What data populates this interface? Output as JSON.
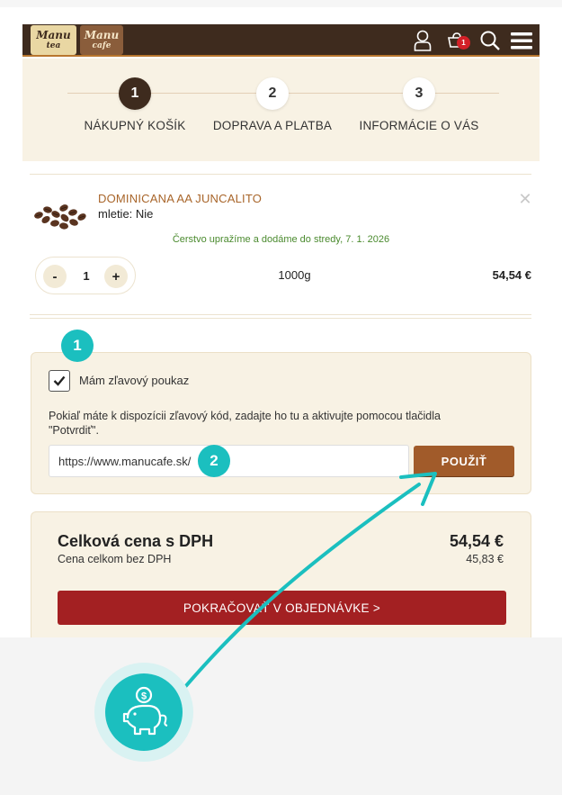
{
  "header": {
    "logo_left": "Manu",
    "logo_left_sub": "tea",
    "logo_right": "Manu",
    "logo_right_sub": "cafe",
    "cart_count": "1",
    "icons": [
      "user-icon",
      "cart-icon",
      "search-icon",
      "menu-icon"
    ]
  },
  "steps": [
    {
      "number": "1",
      "label": "NÁKUPNÝ KOŠÍK",
      "active": true
    },
    {
      "number": "2",
      "label": "DOPRAVA A PLATBA",
      "active": false
    },
    {
      "number": "3",
      "label": "INFORMÁCIE O VÁS",
      "active": false
    }
  ],
  "product": {
    "name": "DOMINICANA AA JUNCALITO",
    "attribute": "mletie: Nie",
    "delivery_note": "Čerstvo upražíme a dodáme do stredy, 7. 1. 2026",
    "quantity": "1",
    "minus_label": "-",
    "plus_label": "+",
    "weight": "1000g",
    "price": "54,54 €",
    "remove_icon": "close-icon"
  },
  "voucher": {
    "checkbox_checked": true,
    "checkbox_label": "Mám zľavový poukaz",
    "info_text": "Pokiaľ máte k dispozícii zľavový kód, zadajte ho tu a aktivujte pomocou tlačidla \"Potvrdiť\".",
    "input_value": "https://www.manucafe.sk/",
    "apply_label": "POUŽIŤ"
  },
  "totals": {
    "title": "Celková cena s DPH",
    "price": "54,54 €",
    "net_label": "Cena celkom bez DPH",
    "net_price": "45,83 €",
    "continue_label": "POKRAČOVAŤ V OBJEDNÁVKE   >"
  },
  "annotations": {
    "marker1": "1",
    "marker2": "2",
    "accent_color": "#1bbfbf"
  },
  "colors": {
    "header_bg": "#3e2b1e",
    "cream": "#f8f2e4",
    "brown_accent": "#a15b2a",
    "cta_red": "#a32022",
    "delivery_green": "#4a8a2e"
  }
}
